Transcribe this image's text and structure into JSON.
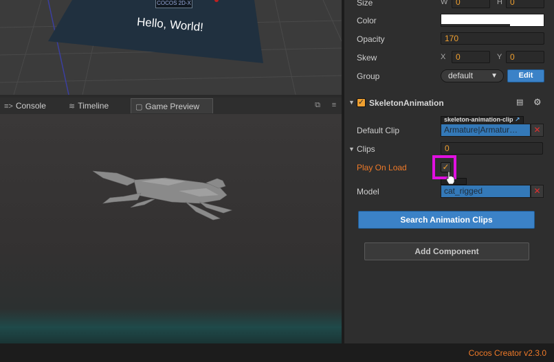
{
  "scene": {
    "logo_text": "COCOS 2D-X",
    "hello_text": "Hello, World!"
  },
  "tabs": [
    {
      "label": "Console",
      "icon": "console-icon"
    },
    {
      "label": "Timeline",
      "icon": "timeline-icon"
    },
    {
      "label": "Game Preview",
      "icon": "camera-icon",
      "active": true
    }
  ],
  "inspector": {
    "size": {
      "label": "Size",
      "w_axis": "W",
      "w_value": "0",
      "h_axis": "H",
      "h_value": "0"
    },
    "color": {
      "label": "Color",
      "value": "#ffffff"
    },
    "opacity": {
      "label": "Opacity",
      "value": "170"
    },
    "skew": {
      "label": "Skew",
      "x_axis": "X",
      "x_value": "0",
      "y_axis": "Y",
      "y_value": "0"
    },
    "group": {
      "label": "Group",
      "value": "default",
      "edit_label": "Edit"
    },
    "component": {
      "title": "SkeletonAnimation",
      "enabled": true,
      "default_clip": {
        "label": "Default Clip",
        "type_tag": "skeleton-animation-clip",
        "value": "Armature|Armatur…"
      },
      "clips": {
        "label": "Clips",
        "value": "0"
      },
      "play_on_load": {
        "label": "Play On Load",
        "checked": true
      },
      "model": {
        "label": "Model",
        "value": "cat_rigged"
      }
    },
    "search_button": "Search Animation Clips",
    "add_component_button": "Add Component"
  },
  "status": {
    "version": "Cocos Creator v2.3.0"
  },
  "colors": {
    "accent_orange": "#f07a28",
    "value_orange": "#f0a030",
    "button_blue": "#3b82c7",
    "highlight_magenta": "#e010e0"
  }
}
